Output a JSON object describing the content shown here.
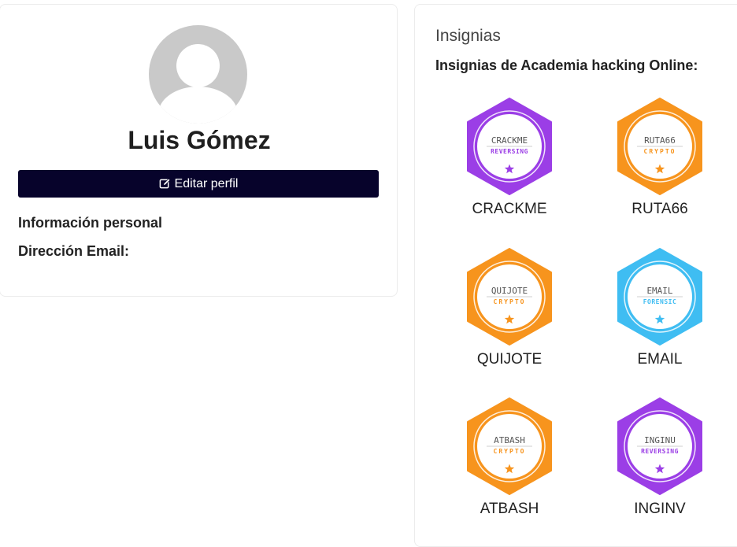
{
  "profile": {
    "name": "Luis Gómez",
    "edit_button": "Editar perfil",
    "personal_info_label": "Información personal",
    "email_label": "Dirección Email:"
  },
  "badges_section": {
    "title": "Insignias",
    "subtitle": "Insignias de Academia hacking Online:",
    "badges": [
      {
        "title": "CRACKME",
        "category": "REVERSING",
        "label": "CRACKME",
        "color": "#9b3ee6"
      },
      {
        "title": "RUTA66",
        "category": "CRYPTO",
        "label": "RUTA66",
        "color": "#f7941d"
      },
      {
        "title": "QUIJOTE",
        "category": "CRYPTO",
        "label": "QUIJOTE",
        "color": "#f7941d"
      },
      {
        "title": "EMAIL",
        "category": "FORENSIC",
        "label": "EMAIL",
        "color": "#3fbdf2"
      },
      {
        "title": "ATBASH",
        "category": "CRYPTO",
        "label": "ATBASH",
        "color": "#f7941d"
      },
      {
        "title": "INGINU",
        "category": "REVERSING",
        "label": "INGINV",
        "color": "#9b3ee6"
      }
    ]
  }
}
